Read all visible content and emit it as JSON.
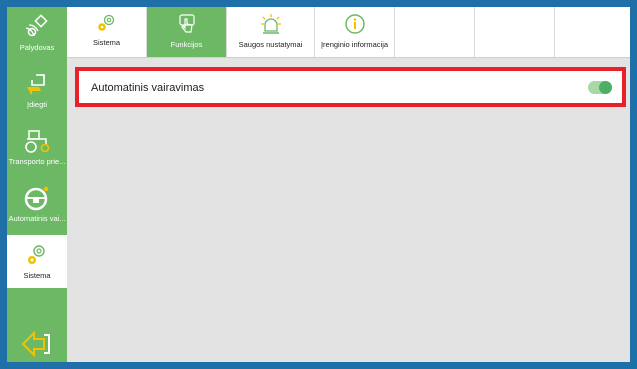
{
  "sidebar": {
    "items": [
      {
        "label": "Palydovas",
        "icon": "satellite-icon"
      },
      {
        "label": "Įdiegti",
        "icon": "install-icon"
      },
      {
        "label": "Transporto prie...",
        "icon": "tractor-icon"
      },
      {
        "label": "Automatinis vai...",
        "icon": "steering-wheel-icon"
      },
      {
        "label": "Sistema",
        "icon": "gear-icon"
      }
    ],
    "back_icon": "back-arrow-icon"
  },
  "tabs": [
    {
      "label": "Sistema",
      "icon": "gear-icon"
    },
    {
      "label": "Funkcijos",
      "icon": "touch-hand-icon"
    },
    {
      "label": "Saugos nustatymai",
      "icon": "warning-light-icon"
    },
    {
      "label": "Įrenginio informacija",
      "icon": "info-icon"
    }
  ],
  "settings": {
    "auto_steering_label": "Automatinis vairavimas",
    "auto_steering_enabled": true
  },
  "colors": {
    "accent": "#6cb865",
    "highlight": "#e8202a",
    "toggle_on": "#4eae63",
    "gear": "#f2c200"
  }
}
